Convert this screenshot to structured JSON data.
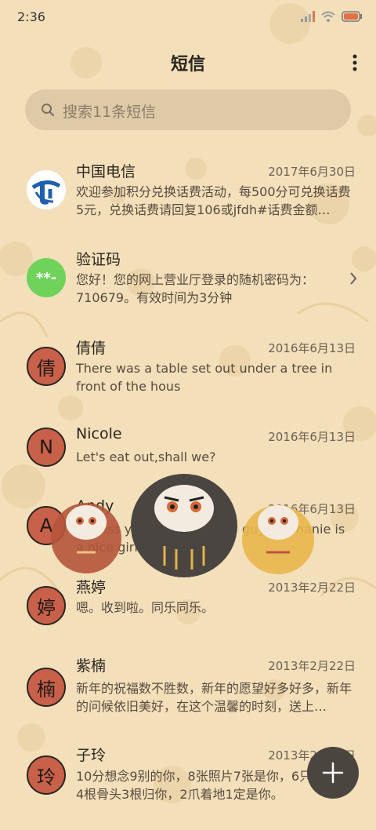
{
  "status_bar": {
    "time": "2:36"
  },
  "header": {
    "title": "短信"
  },
  "search": {
    "placeholder": "搜索11条短信"
  },
  "conversations": [
    {
      "name": "中国电信",
      "date": "2017年6月30日",
      "preview": "欢迎参加积分兑换话费活动，每500分可兑换话费5元，兑换话费请回复106或jfdh#话费金额…",
      "avatar_type": "logo"
    },
    {
      "name": "验证码",
      "date": "",
      "preview": "您好！您的网上营业厅登录的随机密码为：710679。有效时间为3分钟",
      "avatar_type": "code",
      "avatar_text": "**-"
    },
    {
      "name": "倩倩",
      "date": "2016年6月13日",
      "preview": "There was a table set out under a tree in front of the hous",
      "avatar_type": "letter",
      "avatar_text": "倩"
    },
    {
      "name": "Nicole",
      "date": "2016年6月13日",
      "preview": "Let's eat out,shall we?",
      "avatar_type": "letter",
      "avatar_text": "N"
    },
    {
      "name": "Andy",
      "date": "2016年6月13日",
      "preview": "I guess you're some lucky guy.Stephanie is a nice girl.",
      "avatar_type": "letter",
      "avatar_text": "A"
    },
    {
      "name": "燕婷",
      "date": "2013年2月22日",
      "preview": "嗯。收到啦。同乐同乐。",
      "avatar_type": "letter",
      "avatar_text": "婷"
    },
    {
      "name": "紫楠",
      "date": "2013年2月22日",
      "preview": "新年的祝福数不胜数，新年的愿望好多好多，新年的问候依旧美好，在这个温馨的时刻，送上…",
      "avatar_type": "letter",
      "avatar_text": "楠"
    },
    {
      "name": "子玲",
      "date": "2013年2月22日",
      "preview": "10分想念9别的你，8张照片7张是你，6只像你，4根骨头3根归你，2爪着地1定是你。",
      "avatar_type": "letter",
      "avatar_text": "玲"
    }
  ],
  "colors": {
    "background": "#f3dfb9",
    "avatar_letter": "#c8604a",
    "code_avatar": "#6fd35b",
    "fab": "#4b4540"
  },
  "icons": [
    "signal-icon",
    "wifi-icon",
    "battery-icon",
    "more-vertical-icon",
    "search-icon",
    "chevron-right-icon",
    "plus-icon"
  ]
}
